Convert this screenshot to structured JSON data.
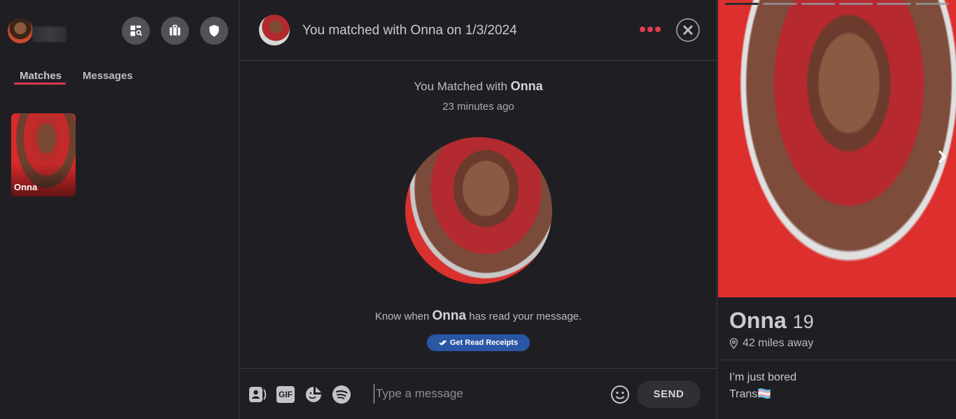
{
  "sidebar": {
    "tabs": [
      {
        "label": "Matches"
      },
      {
        "label": "Messages"
      }
    ],
    "matches": [
      {
        "name": "Onna"
      }
    ]
  },
  "chat": {
    "header_title": "You matched with Onna on 1/3/2024",
    "matched_prefix": "You Matched with ",
    "matched_name": "Onna",
    "matched_time": "23 minutes ago",
    "read_prefix": "Know when ",
    "read_name": "Onna",
    "read_suffix": " has read your message.",
    "read_button": "Get Read Receipts",
    "composer": {
      "gif_label": "GIF",
      "placeholder": "Type a message",
      "send_label": "SEND"
    }
  },
  "profile": {
    "name": "Onna",
    "age": "19",
    "distance": "42 miles away",
    "bio": "I’m just bored\nTrans🏳️‍⚧️",
    "photo_count": 6,
    "active_photo": 0
  },
  "colors": {
    "accent": "#d93a4a",
    "read_button": "#2a57a3",
    "background": "#1f1f23"
  }
}
